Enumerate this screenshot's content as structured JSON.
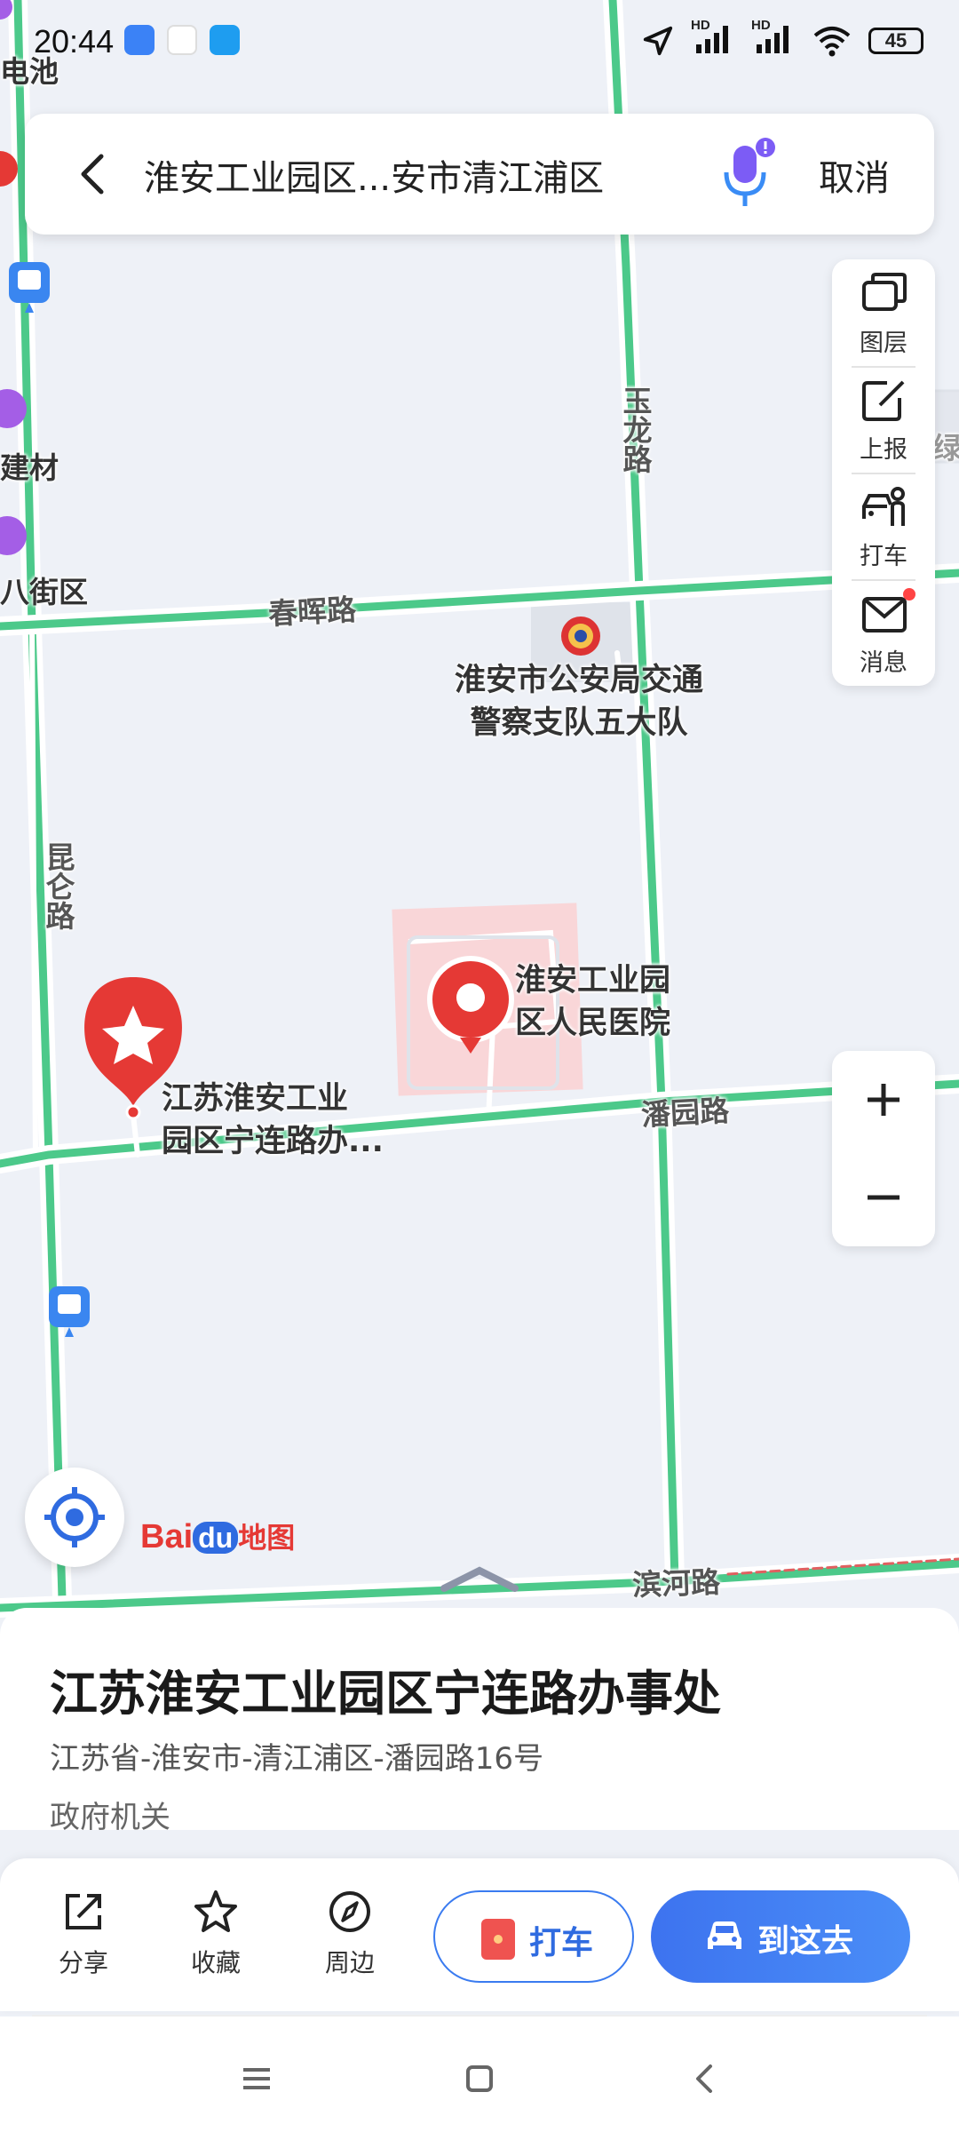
{
  "status_bar": {
    "time": "20:44",
    "battery": "45",
    "hd1": "HD",
    "hd2": "HD"
  },
  "search": {
    "query": "淮安工业园区...安市清江浦区",
    "cancel": "取消"
  },
  "map": {
    "roads": {
      "chunhui": "春晖路",
      "yulong": "玉龙路",
      "kunlun": "昆仑路",
      "panyuan": "潘园路",
      "binhe": "滨河路"
    },
    "pois": {
      "police": [
        "淮安市公安局交通",
        "警察支队五大队"
      ],
      "hospital": [
        "淮安工业园",
        "区人民医院"
      ],
      "selected": [
        "江苏淮安工业",
        "园区宁连路办..."
      ],
      "edge_top": "电池",
      "edge_jiancai": "建材",
      "edge_jiequ": "八街区",
      "edge_right": "绿"
    }
  },
  "tools": [
    {
      "label": "图层",
      "icon": "layers-icon"
    },
    {
      "label": "上报",
      "icon": "report-icon"
    },
    {
      "label": "打车",
      "icon": "taxi-person-icon"
    },
    {
      "label": "消息",
      "icon": "message-icon"
    }
  ],
  "logo": {
    "bai": "Bai",
    "du": "du",
    "ditu": "地图"
  },
  "place": {
    "title": "江苏淮安工业园区宁连路办事处",
    "address": "江苏省-淮安市-清江浦区-潘园路16号",
    "category": "政府机关"
  },
  "actions": {
    "share": "分享",
    "favorite": "收藏",
    "nearby": "周边",
    "taxi": "打车",
    "go": "到这去"
  },
  "colors": {
    "road": "#4cc98a",
    "accent": "#3a7bf0",
    "marker": "#e53935"
  }
}
